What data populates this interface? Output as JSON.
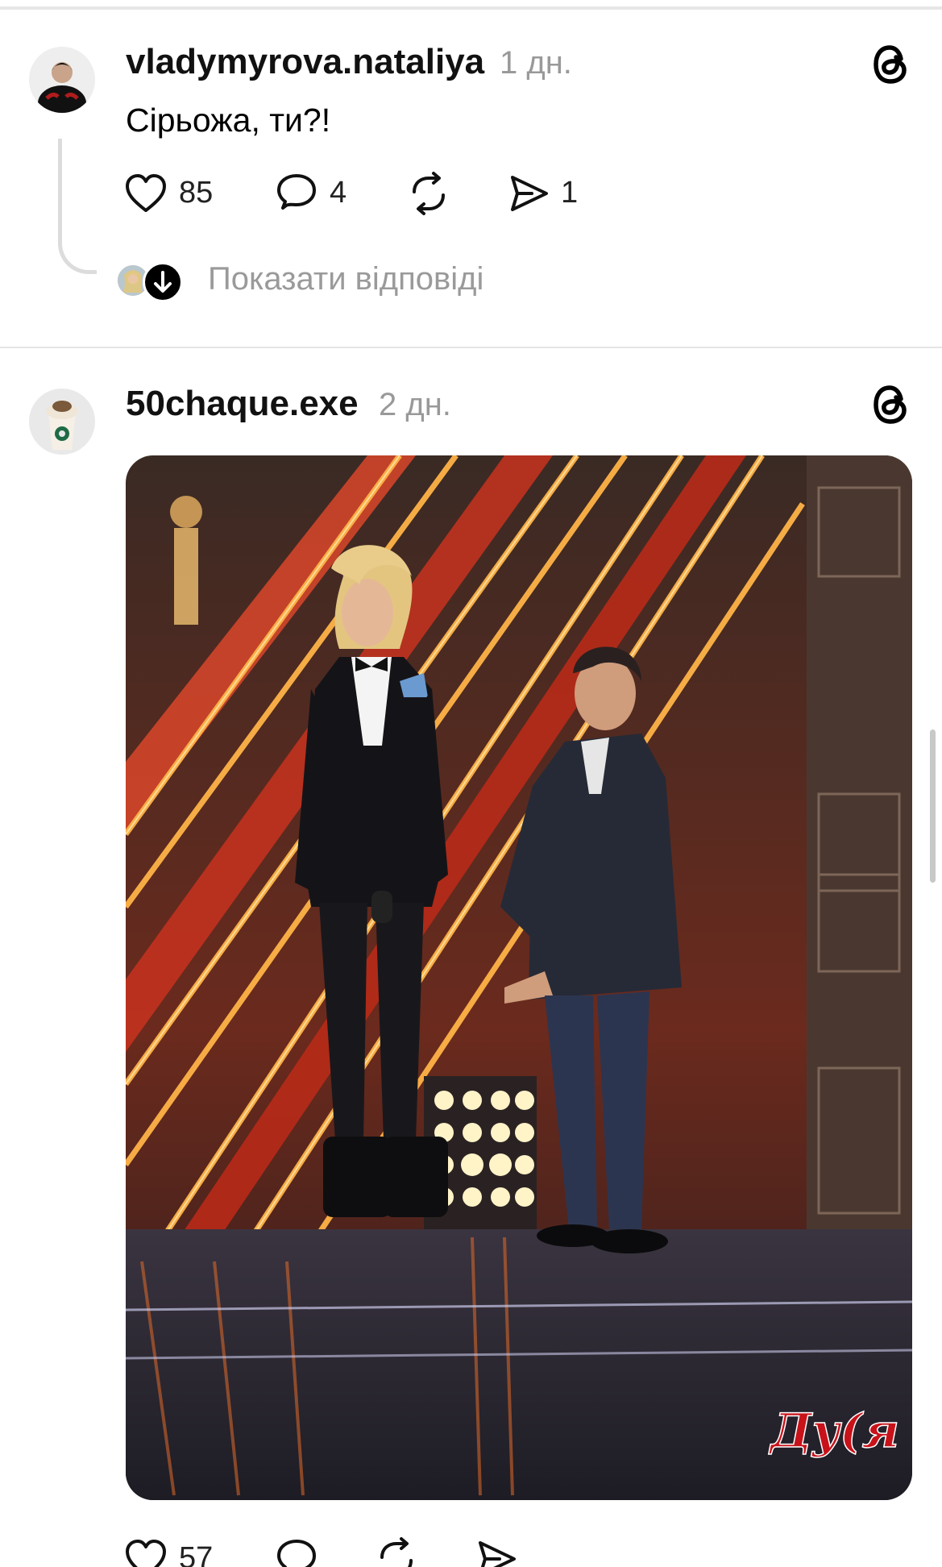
{
  "posts": [
    {
      "username": "vladymyrova.nataliya",
      "time": "1 дн.",
      "text": "Сірьожа, ти?!",
      "likes": "85",
      "comments": "4",
      "shares": "1",
      "show_replies": "Показати відповіді"
    },
    {
      "username": "50chaque.exe",
      "time": "2 дн.",
      "image_watermark": "Ду(я",
      "likes": "57"
    }
  ],
  "colors": {
    "muted": "#999999",
    "divider": "#e5e5e5",
    "thread_line": "#dcdcdc"
  },
  "icons": [
    "threads-logo-icon",
    "heart-icon",
    "comment-icon",
    "repost-icon",
    "send-icon",
    "down-arrow-icon"
  ]
}
